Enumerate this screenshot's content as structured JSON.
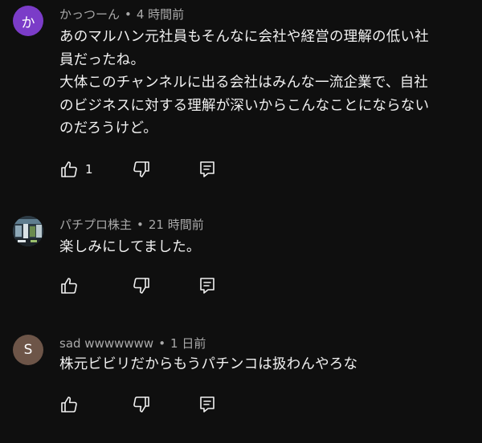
{
  "comments": [
    {
      "avatar_letter": "か",
      "avatar_color": "#7b3cc8",
      "author": "かっつーん",
      "time": "4 時間前",
      "text_lines": [
        "あのマルハン元社員もそんなに会社や経営の理解の低い社",
        "員だったね。",
        "大体このチャンネルに出る会社はみんな一流企業で、自社",
        "のビジネスに対する理解が深いからこんなことにならない",
        "のだろうけど。"
      ],
      "like_count": "1"
    },
    {
      "avatar_letter": "",
      "avatar_color": "#3b4a55",
      "author": "パチプロ株主",
      "time": "21 時間前",
      "text_lines": [
        "楽しみにしてました。"
      ],
      "like_count": ""
    },
    {
      "avatar_letter": "S",
      "avatar_color": "#6d5548",
      "author": "sad wwwwwww",
      "time": "1 日前",
      "text_lines": [
        "株元ビビリだからもうパチンコは扱わんやろな"
      ],
      "like_count": ""
    }
  ],
  "icons": {
    "like": "thumb-up-icon",
    "dislike": "thumb-down-icon",
    "reply": "comment-reply-icon"
  },
  "colors": {
    "background": "#0f0f0f",
    "text": "#f1f1f1",
    "meta": "#aaaaaa"
  }
}
